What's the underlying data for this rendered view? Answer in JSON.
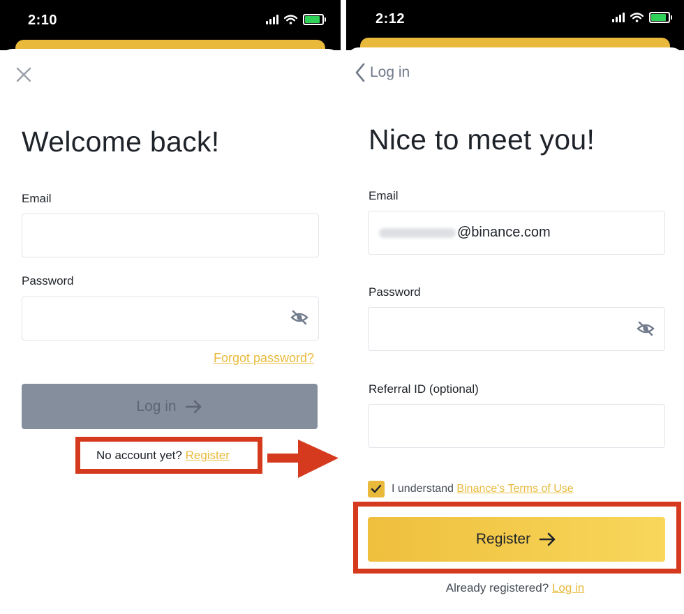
{
  "left": {
    "status_time": "2:10",
    "heading": "Welcome back!",
    "email_label": "Email",
    "email_value": "",
    "password_label": "Password",
    "forgot_password": "Forgot password?",
    "login_button": "Log in",
    "no_account_text": "No account yet?",
    "register_link": "Register"
  },
  "right": {
    "status_time": "2:12",
    "back_label": "Log in",
    "heading": "Nice to meet you!",
    "email_label": "Email",
    "email_value_visible": "@binance.com",
    "password_label": "Password",
    "referral_label": "Referral ID (optional)",
    "terms_text": "I understand",
    "terms_link": "Binance's Terms of Use",
    "terms_checked": true,
    "register_button": "Register",
    "already_registered": "Already registered?",
    "login_link": "Log in"
  },
  "colors": {
    "accent": "#F0B90B",
    "highlight_box": "#D63A1E",
    "disabled_button": "#848E9C",
    "status_bar": "#000000"
  },
  "icons": [
    "close-icon",
    "back-chevron-icon",
    "eye-slash-icon",
    "arrow-right-icon",
    "checkmark-icon",
    "signal-icon",
    "wifi-icon",
    "battery-icon"
  ]
}
